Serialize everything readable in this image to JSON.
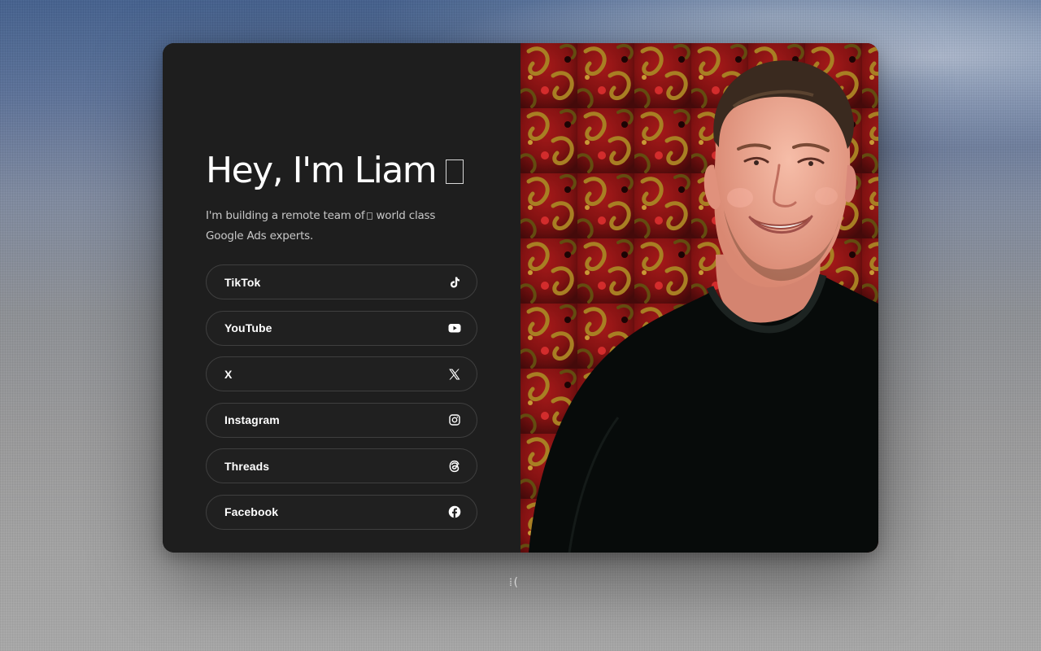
{
  "profile": {
    "headline": "Hey, I'm Liam",
    "headline_emoji": "wave-icon",
    "bio_before": "I'm building a remote team of",
    "bio_after": "world class Google Ads experts."
  },
  "links": [
    {
      "label": "TikTok",
      "icon": "tiktok-icon"
    },
    {
      "label": "YouTube",
      "icon": "youtube-icon"
    },
    {
      "label": "X",
      "icon": "x-icon"
    },
    {
      "label": "Instagram",
      "icon": "instagram-icon"
    },
    {
      "label": "Threads",
      "icon": "threads-icon"
    },
    {
      "label": "Facebook",
      "icon": "facebook-icon"
    }
  ],
  "photo": {
    "subject": "portrait-photo"
  },
  "footer": {
    "glyph": "⁞("
  },
  "colors": {
    "card_background": "#1e1e1e",
    "link_border": "#3f3f3f",
    "text_primary": "#ffffff",
    "text_secondary": "#c8c8c8"
  }
}
